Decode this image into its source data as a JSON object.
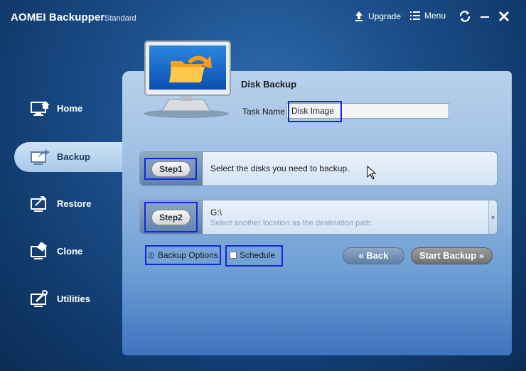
{
  "app": {
    "title": "AOMEI Backupper",
    "edition": "Standard"
  },
  "titlebar": {
    "upgrade_label": "Upgrade",
    "menu_label": "Menu"
  },
  "sidebar": {
    "items": [
      {
        "label": "Home",
        "icon": "monitor-home-icon"
      },
      {
        "label": "Backup",
        "icon": "backup-icon",
        "active": true
      },
      {
        "label": "Restore",
        "icon": "restore-icon"
      },
      {
        "label": "Clone",
        "icon": "clone-icon"
      },
      {
        "label": "Utilities",
        "icon": "utilities-icon"
      }
    ]
  },
  "main": {
    "title": "Disk Backup",
    "task_name_label": "Task Name",
    "task_name_value": "Disk Image",
    "step1": {
      "label": "Step1",
      "text": "Select the disks you need to backup."
    },
    "step2": {
      "label": "Step2",
      "path": "G:\\",
      "hint": "Select another location as the destination path."
    },
    "backup_options_label": "Backup Options",
    "schedule_label": "Schedule",
    "back_label": "Back",
    "start_backup_label": "Start Backup"
  },
  "colors": {
    "highlight": "#1428d8",
    "panel": "#a0c0e3",
    "background": "#1c4f8c"
  }
}
